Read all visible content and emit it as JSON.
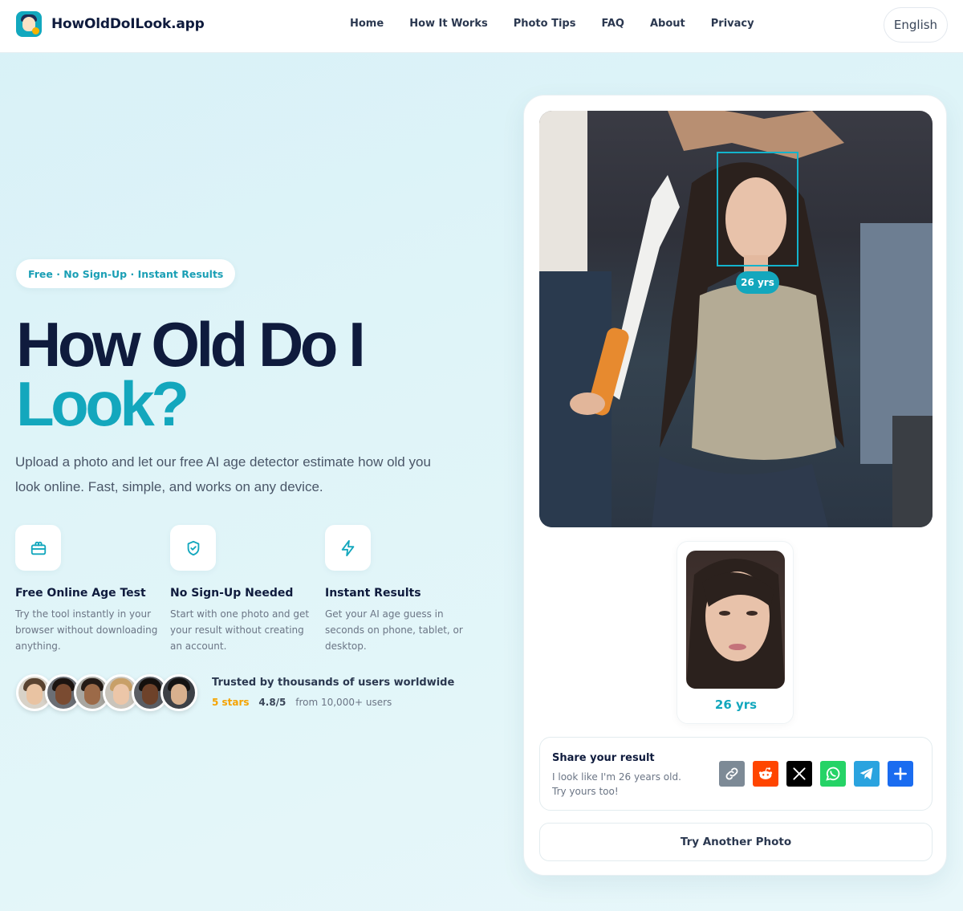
{
  "header": {
    "brand": "HowOldDoILook.app",
    "nav": [
      "Home",
      "How It Works",
      "Photo Tips",
      "FAQ",
      "About",
      "Privacy"
    ],
    "language": "English"
  },
  "hero": {
    "badge": "Free · No Sign-Up · Instant Results",
    "title_line1": "How Old Do I",
    "title_line2": "Look?",
    "lead": "Upload a photo and let our free AI age detector estimate how old you look online. Fast, simple, and works on any device."
  },
  "features": [
    {
      "icon": "gift-icon",
      "title": "Free Online Age Test",
      "text": "Try the tool instantly in your browser without downloading anything."
    },
    {
      "icon": "shield-check-icon",
      "title": "No Sign-Up Needed",
      "text": "Start with one photo and get your result without creating an account."
    },
    {
      "icon": "lightning-icon",
      "title": "Instant Results",
      "text": "Get your AI age guess in seconds on phone, tablet, or desktop."
    }
  ],
  "trust": {
    "headline": "Trusted by thousands of users worldwide",
    "stars": "5 stars",
    "rating": "4.8/5",
    "users": "from 10,000+ users"
  },
  "result": {
    "age_tag": "26 yrs",
    "thumb_age": "26 yrs",
    "share_title": "Share your result",
    "share_text": "I look like I'm 26 years old. Try yours too!",
    "try_again": "Try Another Photo"
  },
  "colors": {
    "accent": "#13a7bd",
    "dark": "#0f1b3d",
    "stars": "#f5a300",
    "reddit": "#ff4500",
    "x": "#000000",
    "whatsapp": "#25d366",
    "telegram": "#2aa3df",
    "share": "#1a6cf0",
    "copy": "#7d8a96"
  }
}
